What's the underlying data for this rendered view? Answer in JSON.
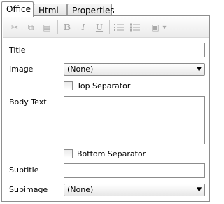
{
  "tabs": [
    {
      "label": "Office"
    },
    {
      "label": "Html"
    },
    {
      "label": "Properties"
    }
  ],
  "toolbar": {
    "cut": "✂",
    "copy": "⧉",
    "paste": "▤",
    "bold": "B",
    "italic": "I",
    "underline": "U",
    "image": "▣",
    "dropdown": "▾"
  },
  "form": {
    "title_label": "Title",
    "image_label": "Image",
    "image_value": "(None)",
    "top_separator_label": "Top Separator",
    "body_text_label": "Body Text",
    "bottom_separator_label": "Bottom Separator",
    "subtitle_label": "Subtitle",
    "subimage_label": "Subimage",
    "subimage_value": "(None)"
  }
}
